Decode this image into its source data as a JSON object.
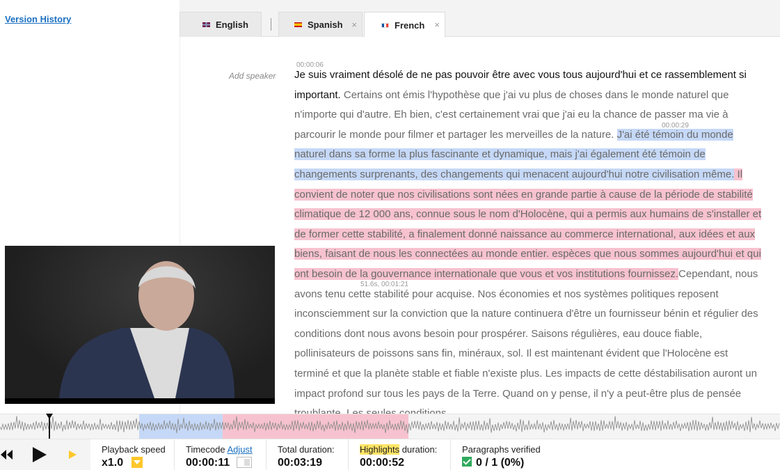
{
  "sidebar": {
    "version_history": "Version History"
  },
  "tabs": [
    {
      "label": "English",
      "flag": "uk-flag-icon",
      "closable": false,
      "active": false
    },
    {
      "label": "Spanish",
      "flag": "spain-flag-icon",
      "closable": true,
      "active": false
    },
    {
      "label": "French",
      "flag": "france-flag-icon",
      "closable": true,
      "active": true
    }
  ],
  "tab_close_glyph": "×",
  "editor": {
    "add_speaker": "Add speaker",
    "timestamps": {
      "start": "00:00:06",
      "mid": "00:00:29",
      "end": "51.6s, 00:01:21"
    },
    "segments": {
      "first": "Je suis vraiment désolé de ne pas pouvoir être avec vous tous aujourd'hui et ce rassemblement si important.",
      "second": " Certains ont émis l'hypothèse que j'ai vu plus de choses dans le monde naturel que n'importe qui d'autre. Eh bien, c'est certainement vrai que j'ai eu la chance de passer ma vie à parcourir le monde pour filmer et partager les merveilles de la nature. ",
      "blue": "J'ai été témoin du monde naturel dans sa forme la plus fascinante et dynamique, mais j'ai également été témoin de changements surprenants, des changements qui menacent aujourd'hui notre civilisation même.",
      "pink": " Il convient de noter que nos civilisations sont nées en grande partie à cause de la période de stabilité climatique de 12 000 ans, connue sous le nom d'Holocène, qui a permis aux humains de s'installer et de former cette stabilité, a finalement donné naissance au commerce international, aux idées et aux biens, faisant de nous les connectées au monde entier. espèces que nous sommes aujourd'hui et qui ont besoin de la gouvernance internationale que vous et vos institutions fournissez.",
      "rest": "Cependant, nous avons tenu cette stabilité pour acquise. Nos économies et nos systèmes politiques reposent inconsciemment sur la conviction que la nature continuera d'être un fournisseur bénin et régulier des conditions dont nous avons besoin pour prospérer. Saisons régulières, eau douce fiable, pollinisateurs de poissons sans fin, minéraux, sol. Il est maintenant évident que l'Holocène est terminé et que la planète stable et fiable n'existe plus. Les impacts de cette déstabilisation auront un impact profond sur tous les pays de la Terre. Quand on y pense, il n'y a peut-être plus de pensée troublante. Les seules conditions"
    }
  },
  "controls": {
    "playback_speed_label": "Playback speed",
    "playback_speed_value": "x1.0",
    "timecode_label": "Timecode",
    "adjust_label": "Adjust",
    "timecode_value": "00:00:11",
    "total_duration_label": "Total duration:",
    "total_duration_value": "00:03:19",
    "highlights_word": "Highlights",
    "highlights_rest": " duration:",
    "highlights_value": "00:00:52",
    "verified_label": "Paragraphs verified",
    "verified_value": "0 / 1 (0%)"
  },
  "colors": {
    "accent": "#1a6fc0",
    "blue_highlight": "#c5d8f7",
    "pink_highlight": "#f7c2cf",
    "yellow": "#ffc72c",
    "green": "#2eaa5c"
  }
}
